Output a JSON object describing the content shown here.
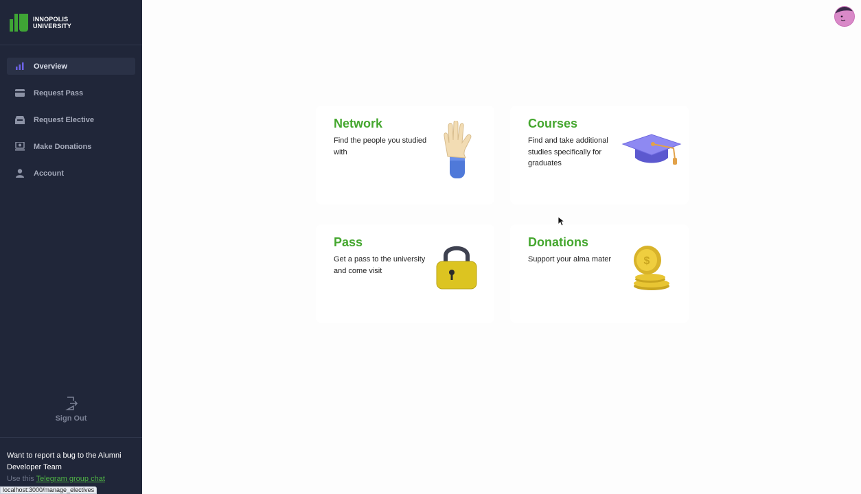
{
  "brand": {
    "line1": "INNOPOLIS",
    "line2": "UNIVERSITY"
  },
  "nav": {
    "items": [
      {
        "label": "Overview",
        "icon": "chart-bars-icon",
        "active": true
      },
      {
        "label": "Request Pass",
        "icon": "card-icon"
      },
      {
        "label": "Request Elective",
        "icon": "inbox-icon"
      },
      {
        "label": "Make Donations",
        "icon": "donate-icon"
      },
      {
        "label": "Account",
        "icon": "user-icon"
      }
    ]
  },
  "signout": {
    "label": "Sign Out"
  },
  "report": {
    "text": "Want to report a bug to the Alumni Developer Team",
    "prefix": "Use this",
    "link": "Telegram group chat"
  },
  "status_bar": {
    "url": "localhost:3000/manage_electives"
  },
  "cards": [
    {
      "title": "Network",
      "description": "Find the people you studied with",
      "icon": "waving-hand-icon"
    },
    {
      "title": "Courses",
      "description": "Find and take additional studies specifically for graduates",
      "icon": "graduation-cap-icon"
    },
    {
      "title": "Pass",
      "description": "Get a pass to the university and come visit",
      "icon": "padlock-icon"
    },
    {
      "title": "Donations",
      "description": "Support your alma mater",
      "icon": "coins-icon"
    }
  ],
  "colors": {
    "sidebar": "#202639",
    "accent": "#45a72f",
    "nav_active_icon": "#6d63e8"
  }
}
